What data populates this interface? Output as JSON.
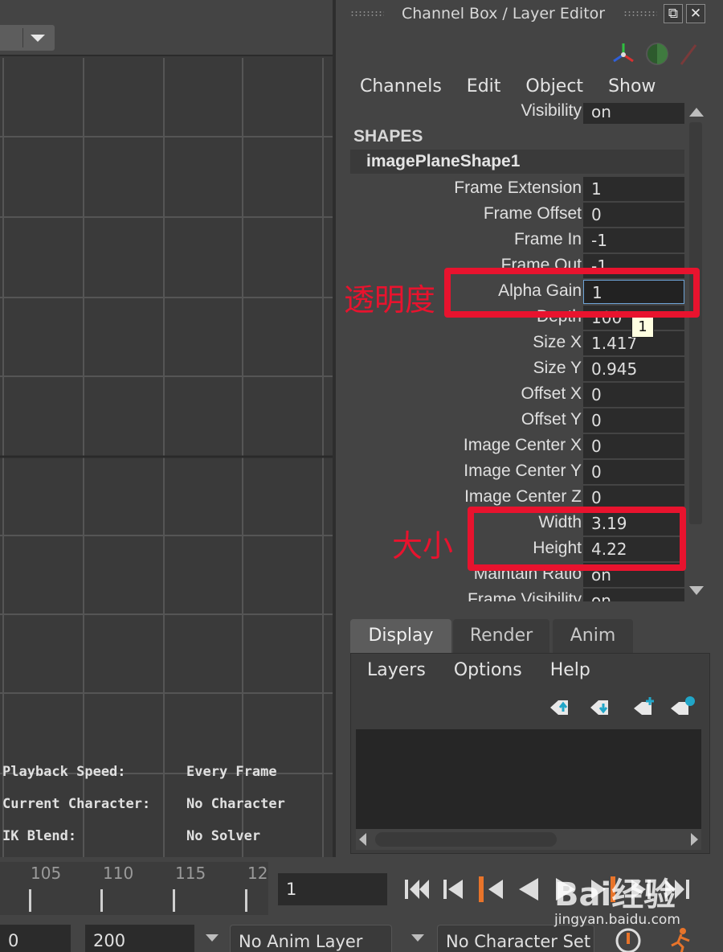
{
  "viewport": {
    "hud": [
      {
        "label": "Playback Speed:",
        "value": "Every Frame"
      },
      {
        "label": "Current Character:",
        "value": "No Character"
      },
      {
        "label": "IK Blend:",
        "value": "No Solver"
      }
    ]
  },
  "channel_box": {
    "title": "Channel Box / Layer Editor",
    "menu": [
      "Channels",
      "Edit",
      "Object",
      "Show"
    ],
    "top_row": {
      "label": "Visibility",
      "value": "on"
    },
    "section": "SHAPES",
    "shape_name": "imagePlaneShape1",
    "attributes": [
      {
        "label": "Frame Extension",
        "value": "1"
      },
      {
        "label": "Frame Offset",
        "value": "0"
      },
      {
        "label": "Frame In",
        "value": "-1"
      },
      {
        "label": "Frame Out",
        "value": "-1"
      },
      {
        "label": "Alpha Gain",
        "value": "1"
      },
      {
        "label": "Depth",
        "value": "100"
      },
      {
        "label": "Size X",
        "value": "1.417"
      },
      {
        "label": "Size Y",
        "value": "0.945"
      },
      {
        "label": "Offset X",
        "value": "0"
      },
      {
        "label": "Offset Y",
        "value": "0"
      },
      {
        "label": "Image Center X",
        "value": "0"
      },
      {
        "label": "Image Center Y",
        "value": "0"
      },
      {
        "label": "Image Center Z",
        "value": "0"
      },
      {
        "label": "Width",
        "value": "3.19"
      },
      {
        "label": "Height",
        "value": "4.22"
      },
      {
        "label": "Maintain Ratio",
        "value": "on"
      },
      {
        "label": "Frame Visibility",
        "value": "on"
      }
    ],
    "tooltip": "1",
    "annotations": {
      "alpha": "透明度",
      "size": "大小"
    }
  },
  "layer_editor": {
    "tabs": [
      "Display",
      "Render",
      "Anim"
    ],
    "active_tab": "Display",
    "menu": [
      "Layers",
      "Options",
      "Help"
    ]
  },
  "timeline": {
    "ticks": [
      "105",
      "110",
      "115",
      "12"
    ],
    "current_frame": "1",
    "range_start": "0",
    "range_end": "200",
    "anim_layer": "No Anim Layer",
    "character_set": "No Character Set"
  },
  "watermark": {
    "brand": "Bai经验",
    "url": "jingyan.baidu.com"
  },
  "colors": {
    "annotation_red": "#e8132e",
    "highlight_orange": "#e8742a",
    "accent_blue": "#6ea3d6"
  }
}
